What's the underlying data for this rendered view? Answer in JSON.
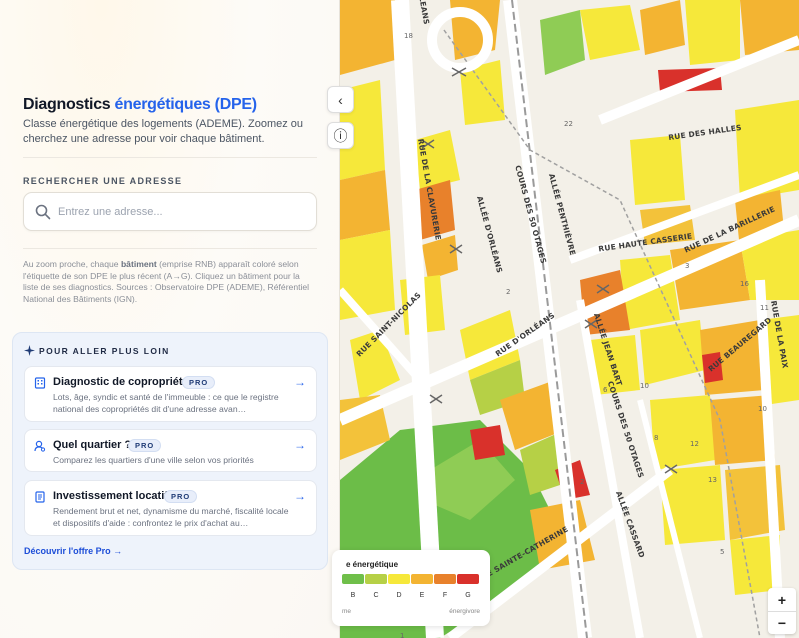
{
  "sidebar": {
    "title_part1": "Diagnostics",
    "title_part2": "énergétiques (DPE)",
    "subtitle": "Classe énergétique des logements (ADEME). Zoomez ou cherchez une adresse pour voir chaque bâtiment.",
    "search_label": "RECHERCHER UNE ADRESSE",
    "search_placeholder": "Entrez une adresse...",
    "info_prefix": "Au zoom proche, chaque",
    "info_bold": "bâtiment",
    "info_rest": "(emprise RNB) apparaît coloré selon l'étiquette de son DPE le plus récent (A→G). Cliquez un bâtiment pour la liste de ses diagnostics. Sources : Observatoire DPE (ADEME), Référentiel National des Bâtiments (IGN)."
  },
  "promo": {
    "heading": "POUR ALLER PLUS LOIN",
    "cards": [
      {
        "title": "Diagnostic de copropriété",
        "badge": "PRO",
        "desc": "Lots, âge, syndic et santé de l'immeuble : ce que le registre national des copropriétés dit d'une adresse avan…",
        "icon": "building-icon"
      },
      {
        "title": "Quel quartier ?",
        "badge": "PRO",
        "desc": "Comparez les quartiers d'une ville selon vos priorités",
        "icon": "user-search-icon"
      },
      {
        "title": "Investissement locatif",
        "badge": "PRO",
        "desc": "Rendement brut et net, dynamisme du marché, fiscalité locale et dispositifs d'aide : confrontez le prix d'achat au…",
        "icon": "document-icon"
      }
    ],
    "link": "Découvrir l'offre Pro →"
  },
  "controls": {
    "collapse": "‹",
    "info": "ⓘ",
    "zoom_in": "+",
    "zoom_out": "−"
  },
  "legend": {
    "title": "e énergétique",
    "letters": [
      "B",
      "C",
      "D",
      "E",
      "F",
      "G"
    ],
    "colors": [
      "#6fbf4a",
      "#b6d046",
      "#f6e83a",
      "#f3b432",
      "#e8812b",
      "#d9312b"
    ],
    "low": "me",
    "high": "énergivore"
  },
  "map": {
    "streets": [
      "RUE DES HALLES",
      "RUE DE LA BARILLERIE",
      "RUE HAUTE CASSERIE",
      "RUE DE LA CLAVURERIE",
      "ALLÉE PENTHIÈVRE",
      "COURS DES 50 OTAGES",
      "ALLÉE D'ORLÉANS",
      "RUE SAINT-NICOLAS",
      "RUE D'ORLÉANS",
      "ALLÉE JEAN BART",
      "RUE BEAUREGARD",
      "RUE DE LA PAIX",
      "COURS DES 50 OTAGES",
      "RUE SAINTE-CATHERINE",
      "ALLÉE CASSARD",
      "LEANS"
    ],
    "numbers": [
      "18",
      "22",
      "2",
      "10",
      "8",
      "12",
      "11",
      "3",
      "6",
      "10",
      "16",
      "13",
      "2",
      "1",
      "5"
    ]
  }
}
